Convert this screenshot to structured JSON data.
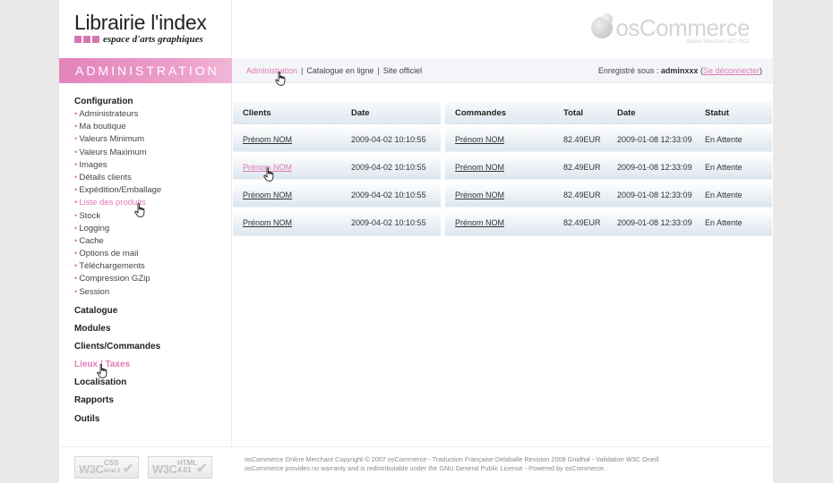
{
  "header": {
    "logo_title": "Librairie l'index",
    "logo_tagline": "espace d'arts graphiques",
    "brand": "osCommerce",
    "brand_version": "Online Merchant v2.2 RC1"
  },
  "admin_label": "ADMINISTRATION",
  "topnav": {
    "links": [
      "Administration",
      "Catalogue en ligne",
      "Site officiel"
    ],
    "separator": "|",
    "user_prefix": "Enregistré sous :",
    "username": "adminxxx",
    "logout": "Se déconnecter"
  },
  "sidebar": {
    "group_title": "Configuration",
    "bullet": "•",
    "items": [
      "Administrateurs",
      "Ma boutique",
      "Valeurs Minimum",
      "Valeurs Maximum",
      "Images",
      "Détails clients",
      "Expédition/Emballage",
      "Liste des produits",
      "Stock",
      "Logging",
      "Cache",
      "Options de mail",
      "Téléchargements",
      "Compression GZip",
      "Session"
    ],
    "categories": [
      "Catalogue",
      "Modules",
      "Clients/Commandes",
      "Lieux / Taxes",
      "Localisation",
      "Rapports",
      "Outils"
    ]
  },
  "clients_table": {
    "headers": [
      "Clients",
      "Date"
    ],
    "rows": [
      [
        "Prénom NOM",
        "2009-04-02 10:10:55"
      ],
      [
        "Prénom NOM",
        "2009-04-02 10:10:55"
      ],
      [
        "Prénom NOM",
        "2009-04-02 10:10:55"
      ],
      [
        "Prénom NOM",
        "2009-04-02 10:10:55"
      ]
    ]
  },
  "orders_table": {
    "headers": [
      "Commandes",
      "Total",
      "Date",
      "Statut"
    ],
    "rows": [
      [
        "Prénom NOM",
        "82.49EUR",
        "2009-01-08 12:33:09",
        "En Attente"
      ],
      [
        "Prénom NOM",
        "82.49EUR",
        "2009-01-08 12:33:09",
        "En Attente"
      ],
      [
        "Prénom NOM",
        "82.49EUR",
        "2009-01-08 12:33:09",
        "En Attente"
      ],
      [
        "Prénom NOM",
        "82.49EUR",
        "2009-01-08 12:33:09",
        "En Attente"
      ]
    ]
  },
  "footer": {
    "badge_css": {
      "w3c": "W3C",
      "label1": "CSS",
      "label2": "level 2"
    },
    "badge_html": {
      "w3c": "W3C",
      "label1": "HTML",
      "label2": "4.01"
    },
    "copyright_line1": "osCommerce Online Merchant Copyright © 2007 osCommerce - Traduction Française Delaballe Revision 2008 Gnidhal - Validation W3C Oneill",
    "copyright_line2": "osCommerce provides no warranty and is redistributable under the GNU General Public License - Powered by osCommerce."
  },
  "colors": {
    "accent_pink": "#e07ab5",
    "admin_bar": "#e383bb",
    "table_header": "#dee6ef"
  }
}
